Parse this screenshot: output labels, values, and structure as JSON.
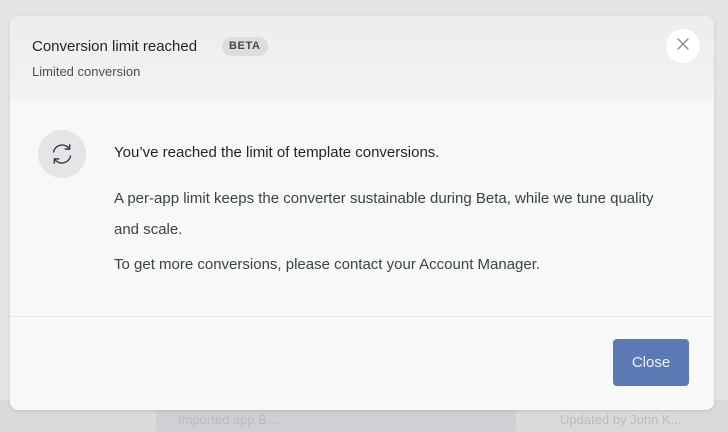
{
  "background": {
    "text_left": "Imported app B...",
    "text_right": "Updated by John K..."
  },
  "dialog": {
    "title": "Conversion limit reached",
    "badge": "BETA",
    "subtitle": "Limited conversion",
    "close_icon": "close-icon",
    "status_icon": "sync-icon",
    "heading": "You’ve reached the limit of template conversions.",
    "paragraph_1": "A per-app limit keeps the converter sustainable during Beta, while we tune quality and scale.",
    "paragraph_2": "To get more conversions, please contact your Account Manager.",
    "close_label": "Close"
  },
  "colors": {
    "primary_button": "#5b79b3",
    "overlay": "#e3e4e6"
  }
}
